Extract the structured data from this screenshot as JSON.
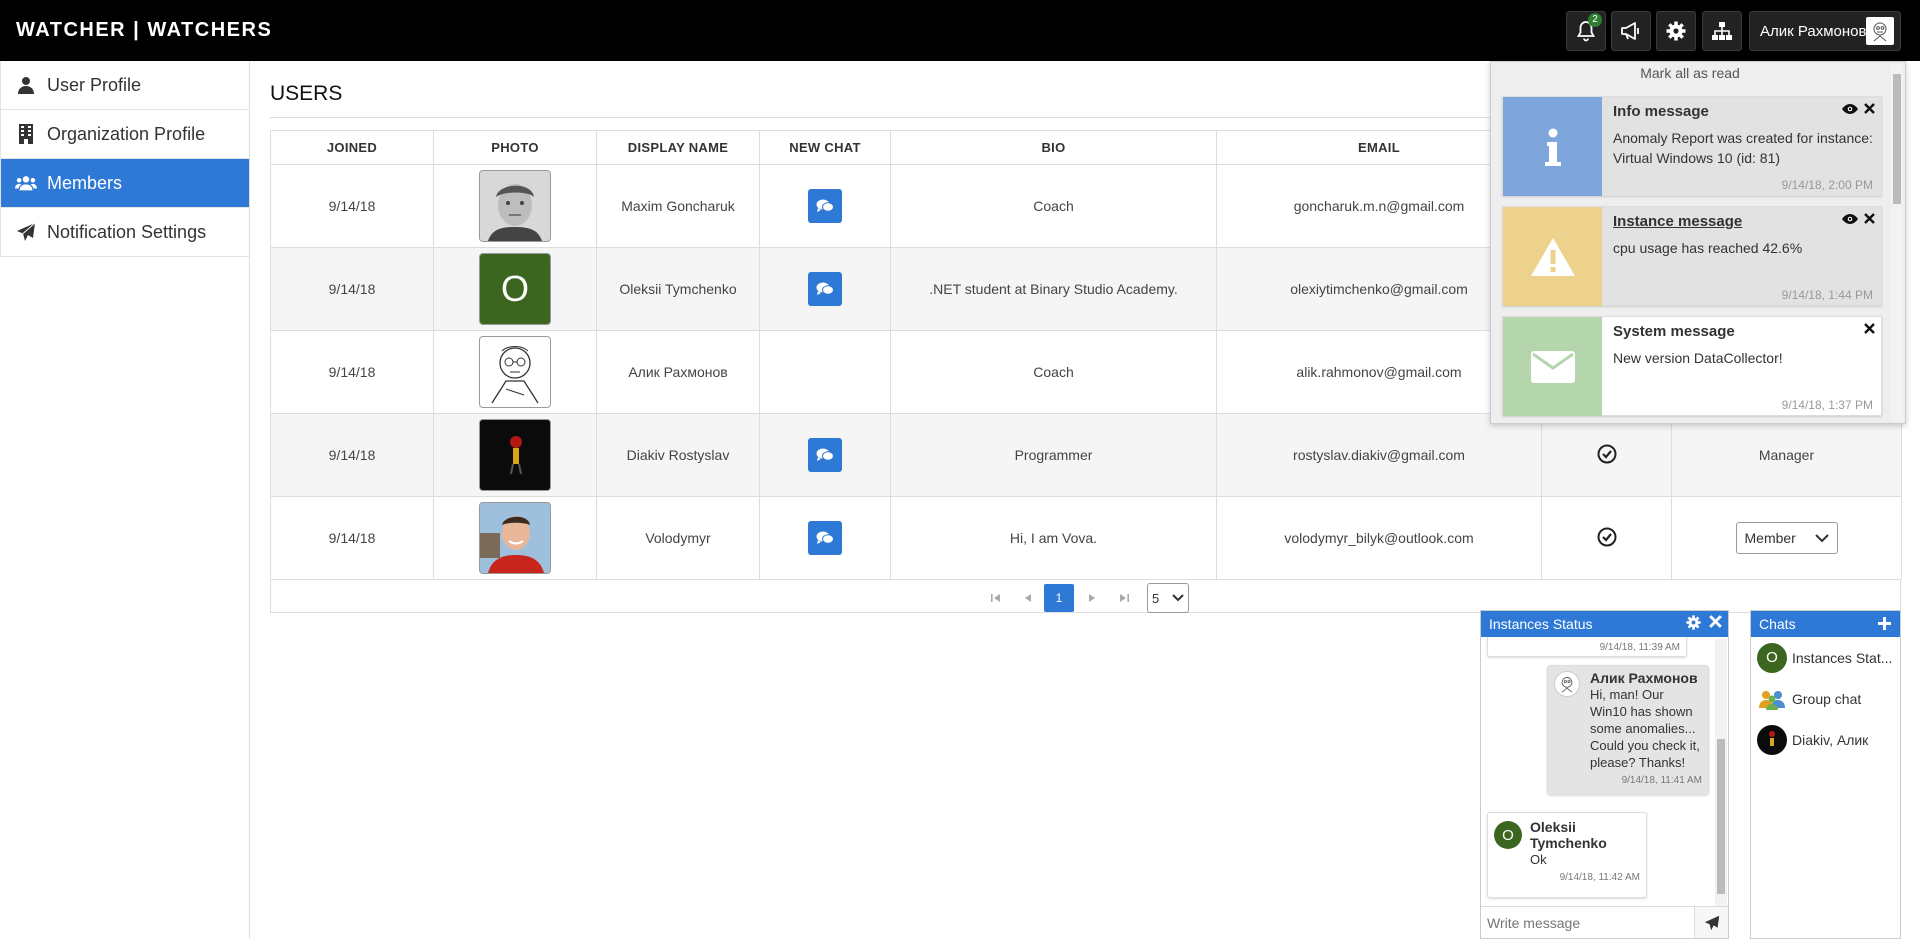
{
  "app": {
    "brand": "WATCHER | WATCHERS",
    "notification_count": "2",
    "user_name": "Алик Рахмонов"
  },
  "sidebar": {
    "items": [
      {
        "label": "User Profile",
        "icon": "user-icon"
      },
      {
        "label": "Organization Profile",
        "icon": "building-icon"
      },
      {
        "label": "Members",
        "icon": "users-icon",
        "active": true
      },
      {
        "label": "Notification Settings",
        "icon": "paper-plane-icon"
      }
    ]
  },
  "users": {
    "title": "USERS",
    "columns": [
      "JOINED",
      "PHOTO",
      "DISPLAY NAME",
      "NEW CHAT",
      "BIO",
      "EMAIL",
      "",
      ""
    ],
    "rows": [
      {
        "joined": "9/14/18",
        "name": "Maxim Goncharuk",
        "bio": "Coach",
        "email": "goncharuk.m.n@gmail.com",
        "role": ""
      },
      {
        "joined": "9/14/18",
        "name": "Oleksii Tymchenko",
        "photo_letter": "O",
        "bio": ".NET student at Binary Studio Academy.",
        "email": "olexiytimchenko@gmail.com",
        "role": ""
      },
      {
        "joined": "9/14/18",
        "name": "Алик Рахмонов",
        "bio": "Coach",
        "email": "alik.rahmonov@gmail.com",
        "role": ""
      },
      {
        "joined": "9/14/18",
        "name": "Diakiv Rostyslav",
        "bio": "Programmer",
        "email": "rostyslav.diakiv@gmail.com",
        "role": "Manager"
      },
      {
        "joined": "9/14/18",
        "name": "Volodymyr",
        "bio": "Hi, I am Vova.",
        "email": "volodymyr_bilyk@outlook.com",
        "role_select": "Member"
      }
    ],
    "pager": {
      "current": "1",
      "page_size": "5"
    }
  },
  "notifications": {
    "mark_all": "Mark all as read",
    "items": [
      {
        "title": "Info message",
        "body": "Anomaly Report was created for instance: Virtual Windows 10 (id: 81)",
        "time": "9/14/18, 2:00 PM",
        "color": "#7ea6dc"
      },
      {
        "title": "Instance message",
        "body": "cpu usage has reached 42.6%",
        "time": "9/14/18, 1:44 PM",
        "color": "#ecd28c"
      },
      {
        "title": "System message",
        "body": "New version DataCollector!",
        "time": "9/14/18, 1:37 PM",
        "color": "#b5d6ad"
      }
    ]
  },
  "chat": {
    "title": "Instances Status",
    "partial_time": "9/14/18, 11:39 AM",
    "messages": [
      {
        "author": "Алик Рахмонов",
        "text": "Hi, man! Our Win10 has shown some anomalies... Could you check it, please? Thanks!",
        "time": "9/14/18, 11:41 AM"
      },
      {
        "author": "Oleksii Tymchenko",
        "avatar_letter": "O",
        "text": "Ok",
        "time": "9/14/18, 11:42 AM"
      }
    ],
    "input_placeholder": "Write message"
  },
  "chats": {
    "title": "Chats",
    "items": [
      {
        "label": "Instances Stat...",
        "avatar_letter": "O"
      },
      {
        "label": "Group chat"
      },
      {
        "label": "Diakiv, Алик"
      }
    ]
  },
  "colors": {
    "primary": "#2e78d6",
    "topbar": "#000000",
    "badge": "#2e7d32"
  }
}
